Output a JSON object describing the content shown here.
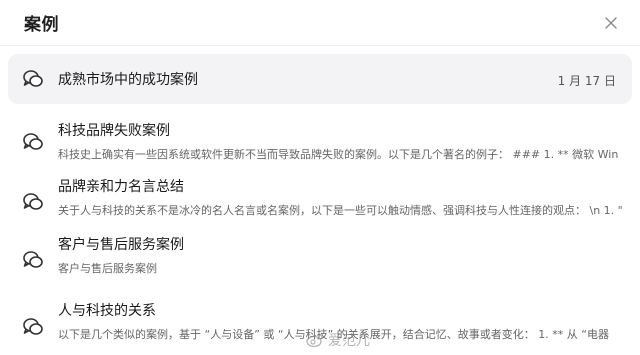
{
  "header": {
    "title": "案例",
    "close_icon": "close-icon"
  },
  "items": [
    {
      "icon": "chat-bubbles-icon",
      "title": "成熟市场中的成功案例",
      "snippet": "",
      "date": "1 月 17 日",
      "active": true
    },
    {
      "icon": "chat-bubbles-icon",
      "title": "科技品牌失败案例",
      "snippet": "科技史上确实有一些因系统或软件更新不当而导致品牌失败的案例。以下是几个著名的例子： ### 1. ** 微软 Win",
      "date": "",
      "active": false
    },
    {
      "icon": "chat-bubbles-icon",
      "title": "品牌亲和力名言总结",
      "snippet": "关于人与科技的关系不是冰冷的名人名言或名案例，以下是一些可以触动情感、强调科技与人性连接的观点： \\n 1. \"",
      "date": "",
      "active": false
    },
    {
      "icon": "chat-bubbles-icon",
      "title": "客户与售后服务案例",
      "snippet": "客户与售后服务案例",
      "date": "",
      "active": false
    },
    {
      "icon": "chat-bubbles-icon",
      "title": "人与科技的关系",
      "snippet": "以下是几个类似的案例，基于 “人与设备” 或 “人与科技” 的关系展开，结合记忆、故事或者变化： 1. ** 从 “电器",
      "date": "",
      "active": false
    }
  ],
  "watermark": {
    "text": "爱范儿"
  }
}
